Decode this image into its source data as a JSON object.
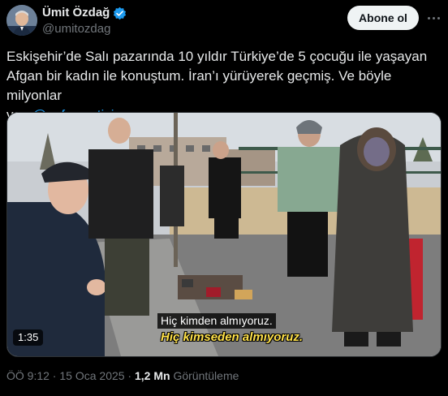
{
  "author": {
    "name": "Ümit Özdağ",
    "handle": "@umitozdag",
    "verified_icon": "verified-badge-icon"
  },
  "follow_button": {
    "label": "Abone ol"
  },
  "tweet": {
    "text_line1": "Eskişehir’de Salı pazarında 10 yıldır Türkiye’de 5 çocuğu ile yaşayan",
    "text_line2": "Afgan bir kadın ile konuştum. İran’ı yürüyerek geçmiş. Ve böyle milyonlar",
    "text_line3_prefix": "var. ",
    "mention": "@zaferpartisi"
  },
  "video": {
    "duration": "1:35",
    "subtitle_line1": "Hiç kimden almıyoruz.",
    "subtitle_line2": "Hiç kimseden almıyoruz."
  },
  "meta": {
    "time": "ÖÖ 9:12",
    "separator": " · ",
    "date": "15 Oca 2025",
    "views": "1,2 Mn",
    "views_label": " Görüntüleme"
  },
  "colors": {
    "accent": "#1d9bf0",
    "background": "#000000",
    "subtitle_highlight": "#ffe14a"
  }
}
